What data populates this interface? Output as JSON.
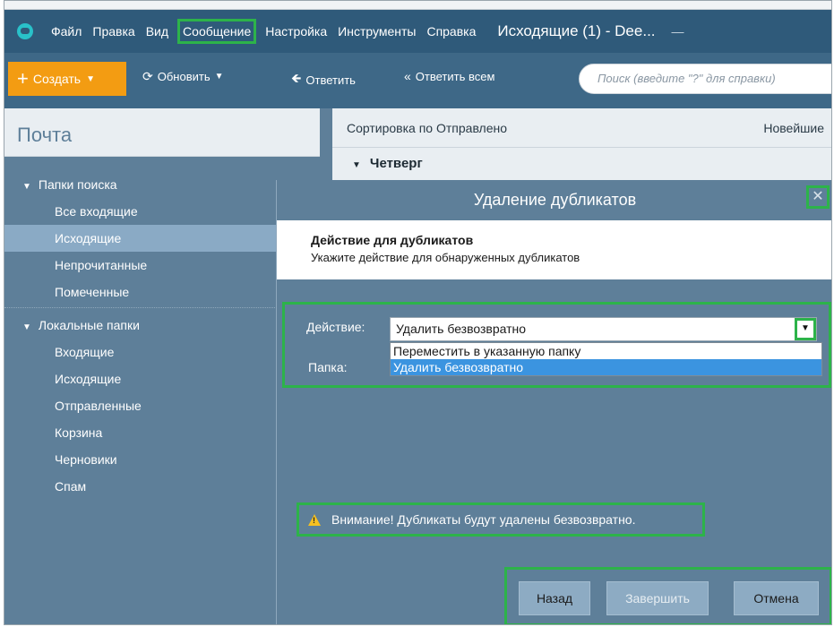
{
  "menubar": {
    "items": [
      "Файл",
      "Правка",
      "Вид",
      "Сообщение",
      "Настройка",
      "Инструменты",
      "Справка"
    ],
    "window_title": "Исходящие (1) - Dee...",
    "minimize": "—"
  },
  "toolbar": {
    "create": "Создать",
    "refresh": "Обновить",
    "reply": "Ответить",
    "reply_all": "Ответить всем",
    "search_placeholder": "Поиск (введите \"?\" для справки)"
  },
  "sidebar": {
    "title": "Почта",
    "search_folders": {
      "label": "Папки поиска",
      "items": [
        "Все входящие",
        "Исходящие",
        "Непрочитанные",
        "Помеченные"
      ]
    },
    "local_folders": {
      "label": "Локальные папки",
      "items": [
        "Входящие",
        "Исходящие",
        "Отправленные",
        "Корзина",
        "Черновики",
        "Спам"
      ]
    }
  },
  "list": {
    "sort_label": "Сортировка по Отправлено",
    "sort_order": "Новейшие",
    "day_group": "Четверг"
  },
  "dialog": {
    "title": "Удаление дубликатов",
    "close": "✕",
    "heading": "Действие для дубликатов",
    "subheading": "Укажите действие для обнаруженных дубликатов",
    "action_label": "Действие:",
    "action_value": "Удалить безвозвратно",
    "folder_label": "Папка:",
    "options": [
      "Переместить в указанную папку",
      "Удалить безвозвратно"
    ],
    "warning": "Внимание! Дубликаты будут удалены безвозвратно.",
    "buttons": {
      "back": "Назад",
      "finish": "Завершить",
      "cancel": "Отмена"
    }
  },
  "colors": {
    "accent": "#f39c12",
    "highlight": "#2db34a",
    "selection": "#3b94e0"
  }
}
